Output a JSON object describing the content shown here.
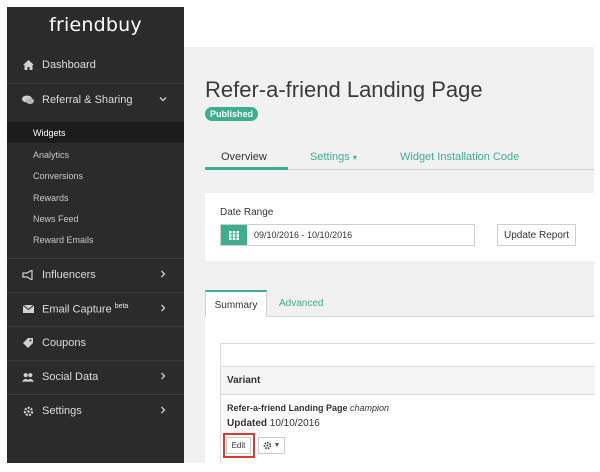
{
  "app": {
    "logo": "friendbuy"
  },
  "sidebar": {
    "items": [
      {
        "label": "Dashboard",
        "icon": "home-icon"
      },
      {
        "label": "Referral & Sharing",
        "icon": "chat-icon",
        "chevron": "chevron-down-icon"
      },
      {
        "label": "Influencers",
        "icon": "megaphone-icon",
        "chevron": "chevron-right-icon"
      },
      {
        "label": "Email Capture",
        "badge": "beta",
        "icon": "envelope-icon",
        "chevron": "chevron-right-icon"
      },
      {
        "label": "Coupons",
        "icon": "tag-icon"
      },
      {
        "label": "Social Data",
        "icon": "users-icon",
        "chevron": "chevron-right-icon"
      },
      {
        "label": "Settings",
        "icon": "gear-icon",
        "chevron": "chevron-right-icon"
      }
    ],
    "subitems": [
      "Widgets",
      "Analytics",
      "Conversions",
      "Rewards",
      "News Feed",
      "Reward Emails"
    ],
    "active_subitem": "Widgets"
  },
  "page": {
    "title": "Refer-a-friend Landing Page",
    "status": "Published"
  },
  "tabs": {
    "overview": "Overview",
    "settings": "Settings",
    "widget_install": "Widget Installation Code"
  },
  "report": {
    "date_range_label": "Date Range",
    "date_range_value": "09/10/2016 - 10/10/2016",
    "update_button": "Update Report"
  },
  "subtabs": {
    "summary": "Summary",
    "advanced": "Advanced"
  },
  "table": {
    "header": "Variant",
    "variant_name": "Refer-a-friend Landing Page",
    "variant_tag": "champion",
    "updated_label": "Updated",
    "updated_date": "10/10/2016",
    "edit_button": "Edit"
  },
  "colors": {
    "sidebar_bg": "#2b2b2b",
    "accent": "#3fae8c",
    "highlight": "#e0372f"
  }
}
